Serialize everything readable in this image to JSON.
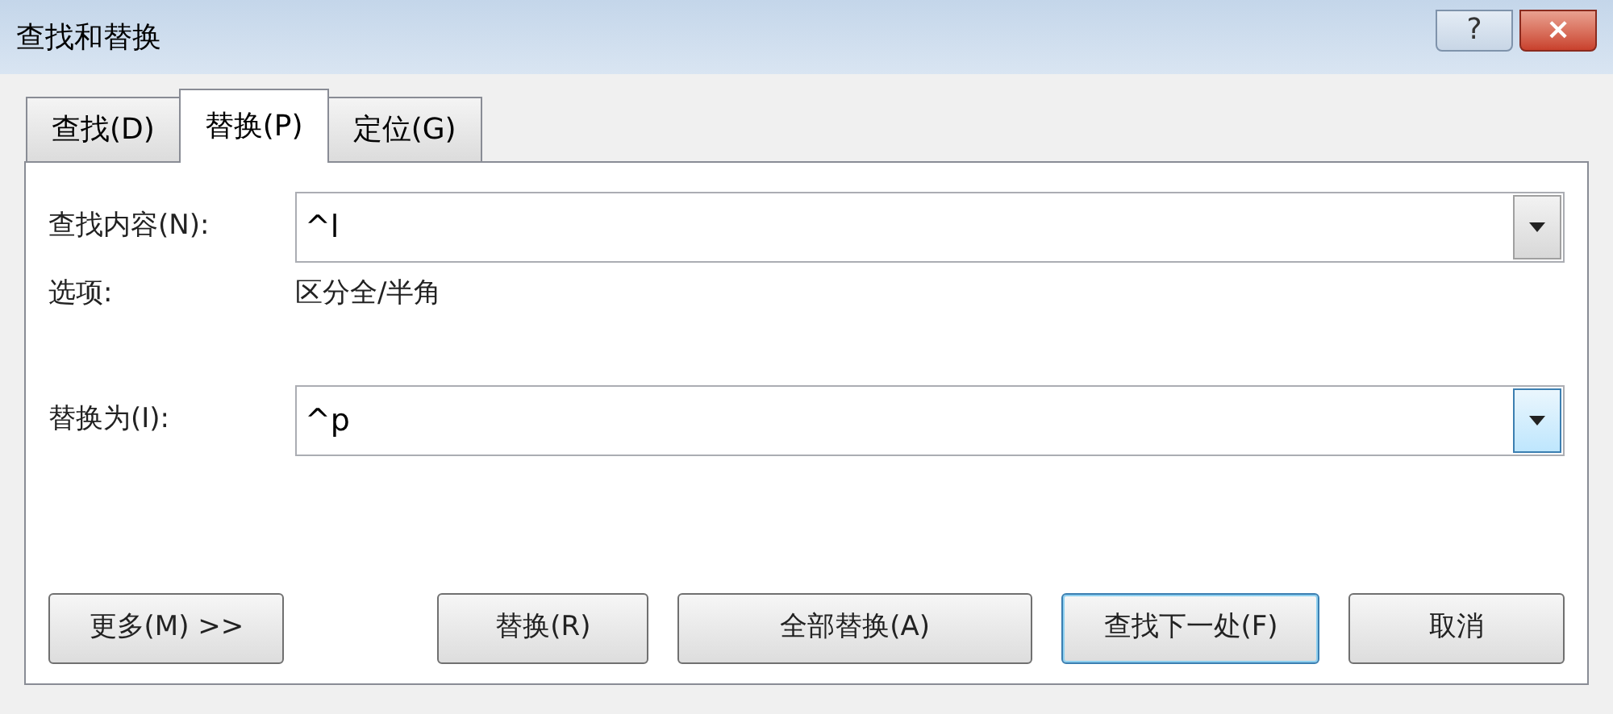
{
  "window": {
    "title": "查找和替换",
    "controls": [
      {
        "kind": "help",
        "label": "?"
      },
      {
        "kind": "close",
        "label": "×"
      }
    ]
  },
  "tabs": [
    {
      "label": "查找(D)",
      "selected": false
    },
    {
      "label": "替换(P)",
      "selected": true
    },
    {
      "label": "定位(G)",
      "selected": false
    }
  ],
  "find": {
    "label": "查找内容(N):",
    "value": "^l",
    "hovered": false
  },
  "options": {
    "label": "选项:",
    "value": "区分全/半角"
  },
  "replace": {
    "label": "替换为(I):",
    "value": "^p",
    "hovered": true
  },
  "buttons": [
    {
      "label": "更多(M) >>",
      "default": false
    },
    {
      "label": "替换(R)",
      "default": false
    },
    {
      "label": "全部替换(A)",
      "default": false
    },
    {
      "label": "查找下一处(F)",
      "default": true
    },
    {
      "label": "取消",
      "default": false
    }
  ]
}
